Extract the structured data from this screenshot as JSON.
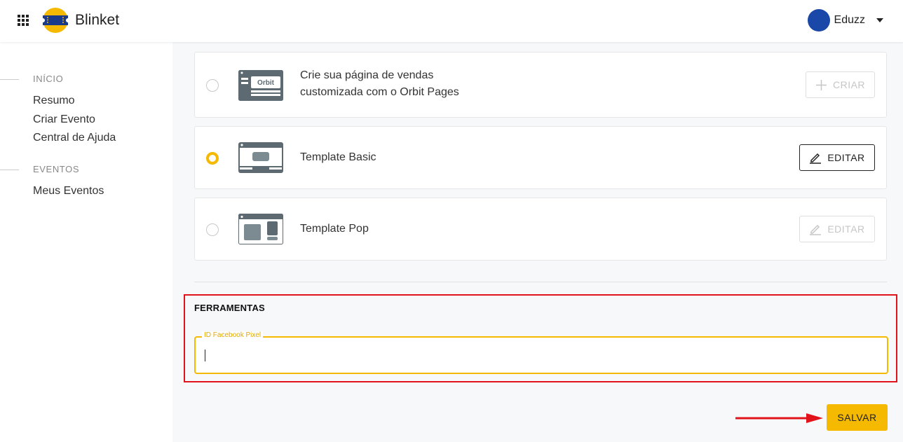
{
  "header": {
    "brand": "Blinket",
    "user_name": "Eduzz",
    "avatar_color": "#1a48a8"
  },
  "sidebar": {
    "sections": [
      {
        "title": "INÍCIO",
        "items": [
          "Resumo",
          "Criar Evento",
          "Central de Ajuda"
        ]
      },
      {
        "title": "EVENTOS",
        "items": [
          "Meus Eventos"
        ]
      }
    ]
  },
  "templates": [
    {
      "text_line1": "Crie sua página de vendas",
      "text_line2": "customizada com o Orbit Pages",
      "button": "CRIAR",
      "selected": false,
      "button_enabled": false,
      "icon": "orbit-page-icon"
    },
    {
      "text": "Template Basic",
      "button": "EDITAR",
      "selected": true,
      "button_enabled": true,
      "icon": "template-basic-icon"
    },
    {
      "text": "Template Pop",
      "button": "EDITAR",
      "selected": false,
      "button_enabled": false,
      "icon": "template-pop-icon"
    }
  ],
  "orbit_logo_text": "Orbit",
  "tools": {
    "title": "FERRAMENTAS",
    "pixel_label": "ID Facebook Pixel",
    "pixel_value": ""
  },
  "save_label": "SALVAR",
  "colors": {
    "accent": "#f5b900",
    "highlight_border": "#e0141a",
    "arrow": "#e0141a"
  }
}
